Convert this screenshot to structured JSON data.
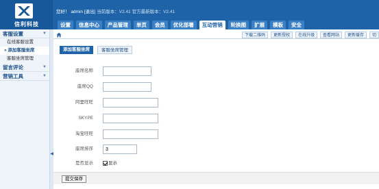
{
  "header": {
    "logo_text": "信利科技",
    "greeting": "您好！",
    "username": "admin",
    "logout": "[退出]",
    "current_version_label": "当前版本：V2.41",
    "latest_version_label": "官方最新版本：V2.41"
  },
  "nav": {
    "tabs": [
      "设置",
      "信息中心",
      "产品管理",
      "单页",
      "会员",
      "优化部署",
      "互动营销",
      "轮换图",
      "扩展",
      "模板",
      "安全"
    ],
    "active": "互动营销"
  },
  "toolbar": {
    "buttons": [
      "下载二维码",
      "更新授权",
      "在线升级",
      "查看网站",
      "更新缓存"
    ],
    "overflow": "切"
  },
  "sidebar": {
    "groups": [
      {
        "label": "客服设置",
        "items": [
          "在线客服设置",
          "» 添加客服坐席",
          "客服坐席管理"
        ]
      },
      {
        "label": "留言评论",
        "items": []
      },
      {
        "label": "营销工具",
        "items": []
      }
    ],
    "active_item": "» 添加客服坐席"
  },
  "subtabs": {
    "add": "添加客服坐席",
    "manage": "客服坐席管理"
  },
  "form": {
    "seat_name_label": "座席名称",
    "qq_label": "座席QQ",
    "aliwangwang_label": "阿里旺旺",
    "skype_label": "SKYPE",
    "taobao_label": "淘宝旺旺",
    "order_label": "座席排序",
    "order_value": "3",
    "show_label": "是否显示",
    "show_checkbox_label": "显示",
    "show_checked": true
  },
  "submit": {
    "label": "提交保存"
  },
  "colors": {
    "brand": "#1e63a8",
    "sidebar_bg": "#eef4fa"
  }
}
